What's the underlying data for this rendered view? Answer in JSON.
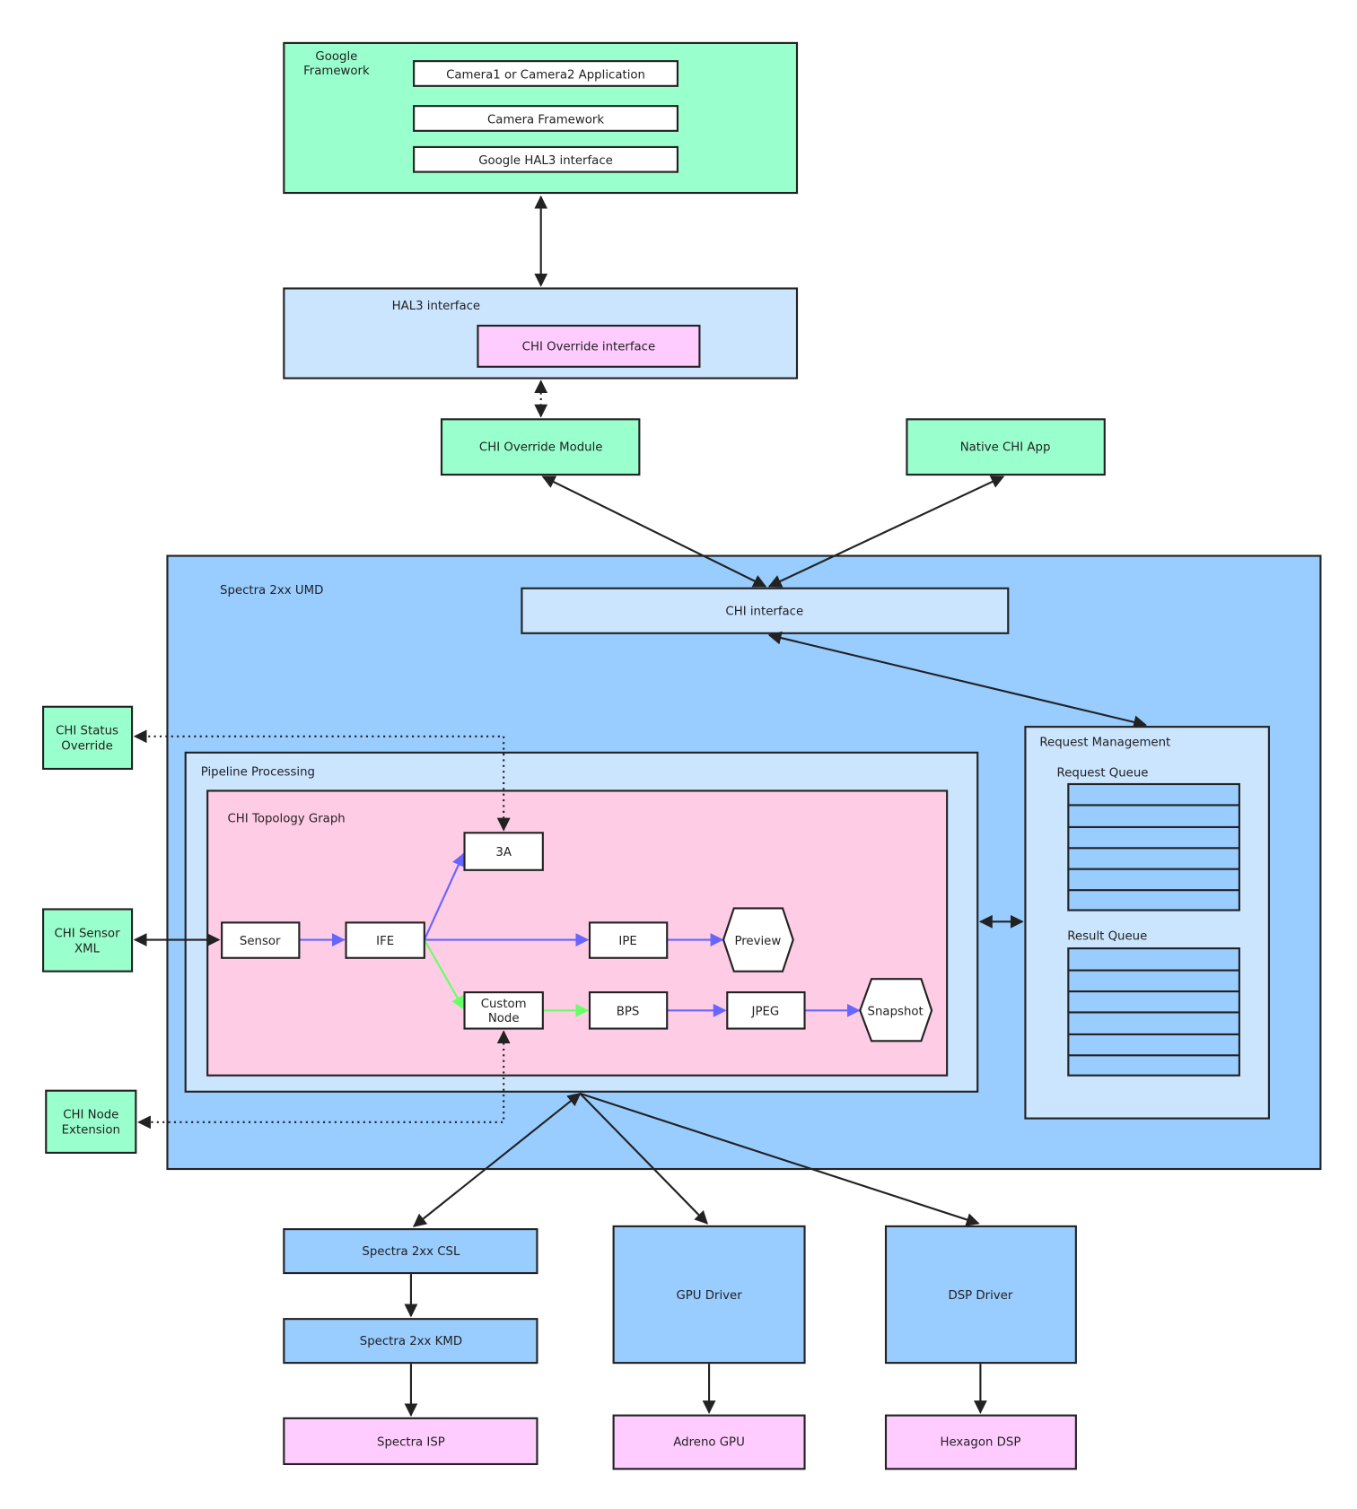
{
  "colors": {
    "framework_green": "#99ffcc",
    "light_blue": "#cce5ff",
    "umd_blue": "#99ccff",
    "pink": "#ffccff",
    "topology_pink": "#ffcce6",
    "flow_blue": "#6666ff",
    "flow_green": "#66ff66"
  },
  "google_framework": {
    "label_line1": "Google",
    "label_line2": "Framework",
    "app": "Camera1 or Camera2 Application",
    "framework": "Camera Framework",
    "hal3": "Google HAL3 interface"
  },
  "hal3": {
    "label": "HAL3 interface",
    "override_interface": "CHI Override interface"
  },
  "chi_override_module": "CHI Override Module",
  "native_chi_app": "Native CHI App",
  "umd": {
    "label": "Spectra 2xx UMD",
    "chi_interface": "CHI interface",
    "pipeline": {
      "label": "Pipeline Processing"
    },
    "topology": {
      "label": "CHI Topology Graph",
      "nodes": {
        "a3": "3A",
        "sensor": "Sensor",
        "ife": "IFE",
        "ipe": "IPE",
        "preview": "Preview",
        "custom_line1": "Custom",
        "custom_line2": "Node",
        "bps": "BPS",
        "jpeg": "JPEG",
        "snapshot": "Snapshot"
      }
    },
    "request_management": {
      "label": "Request Management",
      "request_queue": "Request Queue",
      "result_queue": "Result Queue"
    }
  },
  "side": {
    "status_line1": "CHI Status",
    "status_line2": "Override",
    "sensor_line1": "CHI Sensor",
    "sensor_line2": "XML",
    "node_line1": "CHI Node",
    "node_line2": "Extension"
  },
  "bottom": {
    "csl": "Spectra 2xx CSL",
    "kmd": "Spectra 2xx KMD",
    "isp": "Spectra ISP",
    "gpu_driver": "GPU Driver",
    "adreno": "Adreno GPU",
    "dsp_driver": "DSP Driver",
    "hexagon": "Hexagon DSP"
  }
}
